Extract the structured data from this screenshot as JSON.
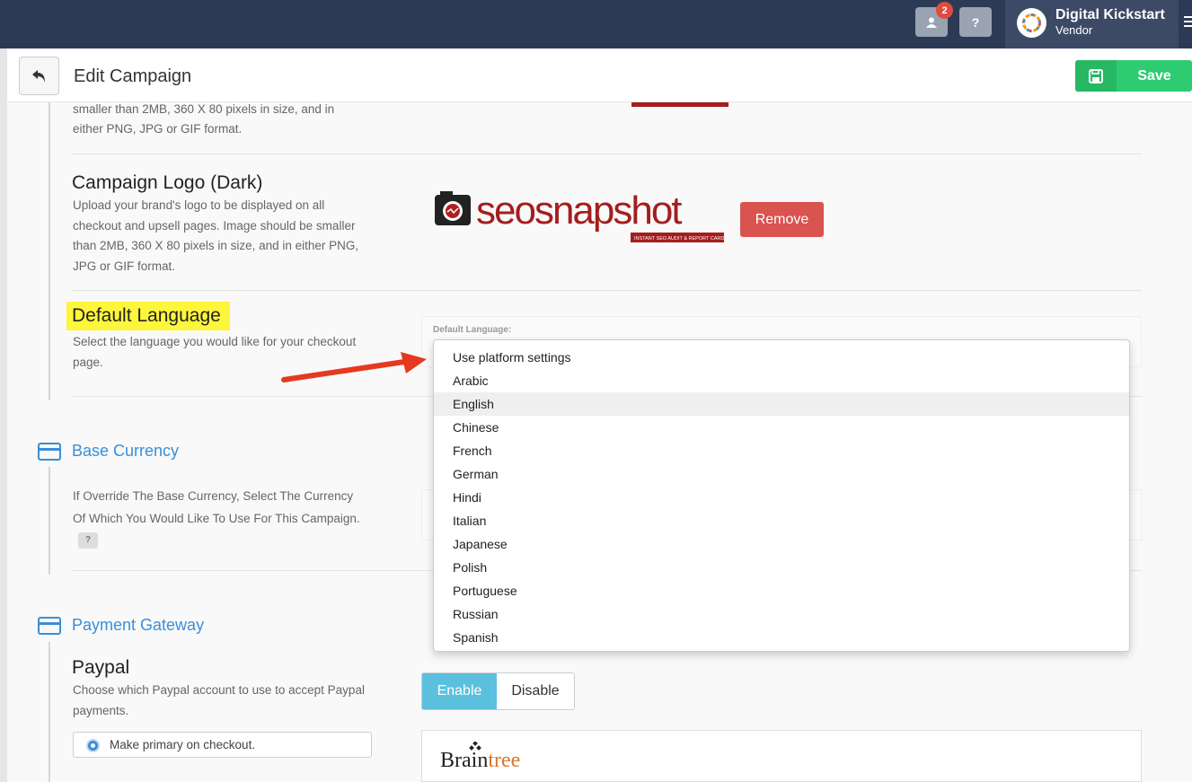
{
  "topbar": {
    "notification_count": "2",
    "help_label": "?",
    "brand_name": "Digital Kickstart",
    "brand_role": "Vendor"
  },
  "header": {
    "title": "Edit Campaign",
    "save_label": "Save"
  },
  "logo_light": {
    "desc_tail_1": "smaller than 2MB, 360 X 80 pixels in size, and in",
    "desc_tail_2": "either PNG, JPG or GIF format."
  },
  "logo_dark": {
    "title": "Campaign Logo (Dark)",
    "desc": "Upload your brand's logo to be displayed on all checkout and upsell pages. Image should be smaller than 2MB, 360 X 80 pixels in size, and in either PNG, JPG or GIF format.",
    "logo_text": "seosnapshot",
    "logo_tagline": "INSTANT SEO AUDIT & REPORT CARD",
    "remove_label": "Remove"
  },
  "language": {
    "title": "Default Language",
    "desc": "Select the language you would like for your checkout page.",
    "field_label": "Default Language:",
    "options": [
      "Use platform settings",
      "Arabic",
      "English",
      "Chinese",
      "French",
      "German",
      "Hindi",
      "Italian",
      "Japanese",
      "Polish",
      "Portuguese",
      "Russian",
      "Spanish"
    ],
    "highlighted": "English"
  },
  "currency": {
    "heading": "Base Currency",
    "desc": "If Override The Base Currency, Select The Currency Of Which You Would Like To Use For This Campaign.",
    "help": "?"
  },
  "gateway": {
    "heading": "Payment Gateway",
    "paypal_title": "Paypal",
    "paypal_desc": "Choose which Paypal account to use to accept Paypal payments.",
    "enable_label": "Enable",
    "disable_label": "Disable",
    "primary_label": "Make primary on checkout.",
    "braintree_a": "Brain",
    "braintree_b": "tree"
  },
  "colors": {
    "topbar": "#2c3a55",
    "save_green": "#2ecc71",
    "remove_red": "#d9534f",
    "accent_blue": "#3a8ed8",
    "enable_blue": "#5bc0de",
    "highlight_yellow": "#fdf63a"
  }
}
